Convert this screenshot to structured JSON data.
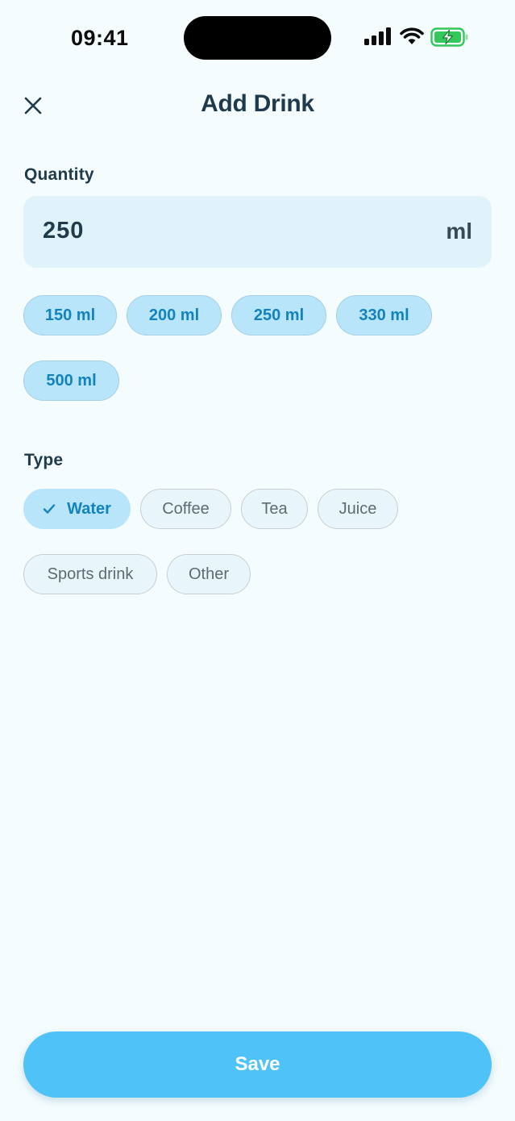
{
  "status_bar": {
    "time": "09:41",
    "icons": [
      "cellular-signal-icon",
      "wifi-icon",
      "battery-charging-icon"
    ]
  },
  "header": {
    "close_icon": "close-icon",
    "title": "Add Drink"
  },
  "quantity": {
    "label": "Quantity",
    "value": "250",
    "unit": "ml",
    "presets": [
      "150 ml",
      "200 ml",
      "250 ml",
      "330 ml",
      "500 ml"
    ]
  },
  "type": {
    "label": "Type",
    "selected": "Water",
    "options": [
      "Water",
      "Coffee",
      "Tea",
      "Juice",
      "Sports drink",
      "Other"
    ]
  },
  "save_label": "Save",
  "colors": {
    "background": "#f5fcfe",
    "accent": "#4fc3f7",
    "chip_selected_bg": "#b9e5fb",
    "chip_selected_text": "#1283bd",
    "field_bg": "#e0f3fb",
    "title_text": "#1e3a4c",
    "battery_green": "#34c759"
  }
}
